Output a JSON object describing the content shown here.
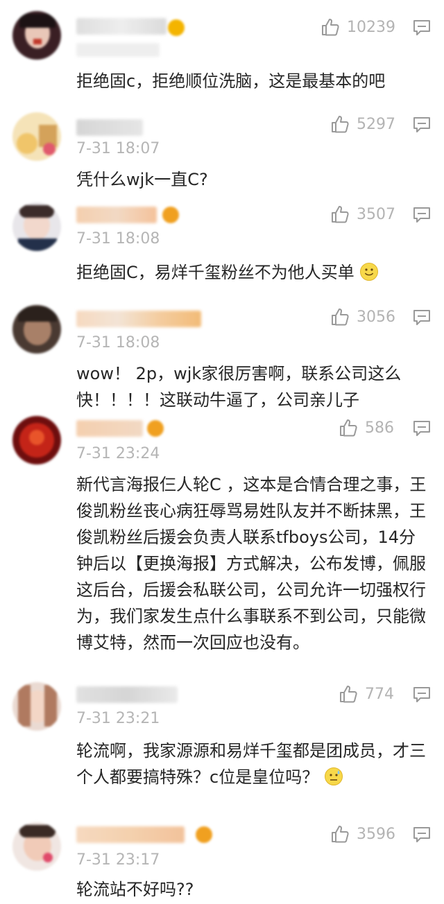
{
  "colors": {
    "text": "#262626",
    "meta": "#b5b5b5",
    "icon": "#999999",
    "badge": "#f4b400"
  },
  "comments": [
    {
      "likes": "10239",
      "time": "",
      "text": "拒绝固c，拒绝顺位洗脑，这是最基本的吧"
    },
    {
      "likes": "5297",
      "time": "7-31 18:07",
      "text": "凭什么wjk一直C?"
    },
    {
      "likes": "3507",
      "time": "7-31 18:08",
      "text": "拒绝固C，易烊千玺粉丝不为他人买单"
    },
    {
      "likes": "3056",
      "time": "7-31 18:08",
      "text": "wow！ 2p，wjk家很厉害啊，联系公司这么快！！！！这联动牛逼了，公司亲儿子"
    },
    {
      "likes": "586",
      "time": "7-31 23:24",
      "text": "新代言海报仨人轮C ，这本是合情合理之事，王俊凯粉丝丧心病狂辱骂易姓队友并不断抹黑，王俊凯粉丝后援会负责人联系tfboys公司，14分钟后以【更换海报】方式解决，公布发博，佩服这后台，后援会私联公司，公司允许一切强权行为，我们家发生点什么事联系不到公司，只能微博艾特，然而一次回应也没有。"
    },
    {
      "likes": "774",
      "time": "7-31 23:21",
      "text": "轮流啊，我家源源和易烊千玺都是团成员，才三个人都要搞特殊？c位是皇位吗？"
    },
    {
      "likes": "3596",
      "time": "7-31 23:17",
      "text": "轮流站不好吗??"
    }
  ]
}
